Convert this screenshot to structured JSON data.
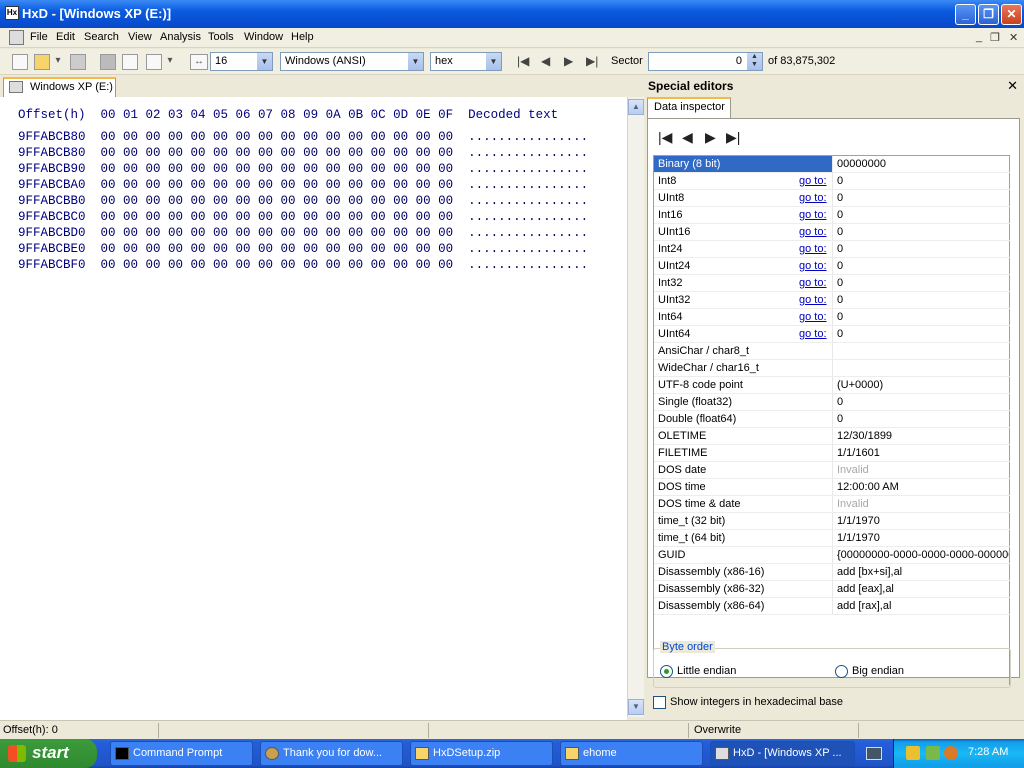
{
  "window": {
    "title": "HxD - [Windows XP (E:)]"
  },
  "menu": [
    "File",
    "Edit",
    "Search",
    "View",
    "Analysis",
    "Tools",
    "Window",
    "Help"
  ],
  "toolbar": {
    "bytes_per_row": "16",
    "charset": "Windows (ANSI)",
    "display": "hex",
    "sector_label": "Sector",
    "sector_value": "0",
    "sector_total": "of 83,875,302"
  },
  "tab": {
    "label": "Windows XP (E:)"
  },
  "hex": {
    "header": {
      "offset": "Offset(h)",
      "columns": "00 01 02 03 04 05 06 07 08 09 0A 0B 0C 0D 0E 0F",
      "decoded": "Decoded text"
    },
    "rows": [
      {
        "offset": "9FFABCB80",
        "bytes": "00 00 00 00 00 00 00 00 00 00 00 00 00 00 00 00",
        "text": "................"
      },
      {
        "offset": "9FFABCB80",
        "bytes": "00 00 00 00 00 00 00 00 00 00 00 00 00 00 00 00",
        "text": "................"
      },
      {
        "offset": "9FFABCB90",
        "bytes": "00 00 00 00 00 00 00 00 00 00 00 00 00 00 00 00",
        "text": "................"
      },
      {
        "offset": "9FFABCBA0",
        "bytes": "00 00 00 00 00 00 00 00 00 00 00 00 00 00 00 00",
        "text": "................"
      },
      {
        "offset": "9FFABCBB0",
        "bytes": "00 00 00 00 00 00 00 00 00 00 00 00 00 00 00 00",
        "text": "................"
      },
      {
        "offset": "9FFABCBC0",
        "bytes": "00 00 00 00 00 00 00 00 00 00 00 00 00 00 00 00",
        "text": "................"
      },
      {
        "offset": "9FFABCBD0",
        "bytes": "00 00 00 00 00 00 00 00 00 00 00 00 00 00 00 00",
        "text": "................"
      },
      {
        "offset": "9FFABCBE0",
        "bytes": "00 00 00 00 00 00 00 00 00 00 00 00 00 00 00 00",
        "text": "................"
      },
      {
        "offset": "9FFABCBF0",
        "bytes": "00 00 00 00 00 00 00 00 00 00 00 00 00 00 00 00",
        "text": "................"
      }
    ]
  },
  "special": {
    "title": "Special editors",
    "tab": "Data inspector"
  },
  "inspector": {
    "goto_label": "go to:",
    "rows": [
      {
        "name": "Binary (8 bit)",
        "value": "00000000",
        "goto": false,
        "selected": true,
        "dim": false
      },
      {
        "name": "Int8",
        "value": "0",
        "goto": true,
        "selected": false,
        "dim": false
      },
      {
        "name": "UInt8",
        "value": "0",
        "goto": true,
        "selected": false,
        "dim": false
      },
      {
        "name": "Int16",
        "value": "0",
        "goto": true,
        "selected": false,
        "dim": false
      },
      {
        "name": "UInt16",
        "value": "0",
        "goto": true,
        "selected": false,
        "dim": false
      },
      {
        "name": "Int24",
        "value": "0",
        "goto": true,
        "selected": false,
        "dim": false
      },
      {
        "name": "UInt24",
        "value": "0",
        "goto": true,
        "selected": false,
        "dim": false
      },
      {
        "name": "Int32",
        "value": "0",
        "goto": true,
        "selected": false,
        "dim": false
      },
      {
        "name": "UInt32",
        "value": "0",
        "goto": true,
        "selected": false,
        "dim": false
      },
      {
        "name": "Int64",
        "value": "0",
        "goto": true,
        "selected": false,
        "dim": false
      },
      {
        "name": "UInt64",
        "value": "0",
        "goto": true,
        "selected": false,
        "dim": false
      },
      {
        "name": "AnsiChar / char8_t",
        "value": "",
        "goto": false,
        "selected": false,
        "dim": false
      },
      {
        "name": "WideChar / char16_t",
        "value": "",
        "goto": false,
        "selected": false,
        "dim": false
      },
      {
        "name": "UTF-8 code point",
        "value": "  (U+0000)",
        "goto": false,
        "selected": false,
        "dim": false
      },
      {
        "name": "Single (float32)",
        "value": "0",
        "goto": false,
        "selected": false,
        "dim": false
      },
      {
        "name": "Double (float64)",
        "value": "0",
        "goto": false,
        "selected": false,
        "dim": false
      },
      {
        "name": "OLETIME",
        "value": "12/30/1899",
        "goto": false,
        "selected": false,
        "dim": false
      },
      {
        "name": "FILETIME",
        "value": "1/1/1601",
        "goto": false,
        "selected": false,
        "dim": false
      },
      {
        "name": "DOS date",
        "value": "Invalid",
        "goto": false,
        "selected": false,
        "dim": true
      },
      {
        "name": "DOS time",
        "value": "12:00:00 AM",
        "goto": false,
        "selected": false,
        "dim": false
      },
      {
        "name": "DOS time & date",
        "value": "Invalid",
        "goto": false,
        "selected": false,
        "dim": true
      },
      {
        "name": "time_t (32 bit)",
        "value": "1/1/1970",
        "goto": false,
        "selected": false,
        "dim": false
      },
      {
        "name": "time_t (64 bit)",
        "value": "1/1/1970",
        "goto": false,
        "selected": false,
        "dim": false
      },
      {
        "name": "GUID",
        "value": "{00000000-0000-0000-0000-000000",
        "goto": false,
        "selected": false,
        "dim": false
      },
      {
        "name": "Disassembly (x86-16)",
        "value": "add [bx+si],al",
        "goto": false,
        "selected": false,
        "dim": false
      },
      {
        "name": "Disassembly (x86-32)",
        "value": "add [eax],al",
        "goto": false,
        "selected": false,
        "dim": false
      },
      {
        "name": "Disassembly (x86-64)",
        "value": "add [rax],al",
        "goto": false,
        "selected": false,
        "dim": false
      }
    ],
    "byte_order": {
      "label": "Byte order",
      "little": "Little endian",
      "big": "Big endian",
      "selected": "little"
    },
    "hex_checkbox": "Show integers in hexadecimal base"
  },
  "status": {
    "offset": "Offset(h): 0",
    "mode": "Overwrite"
  },
  "taskbar": {
    "start": "start",
    "buttons": [
      "Command Prompt",
      "Thank you for dow...",
      "HxDSetup.zip",
      "ehome",
      "HxD - [Windows XP ..."
    ],
    "clock": "7:28 AM"
  }
}
